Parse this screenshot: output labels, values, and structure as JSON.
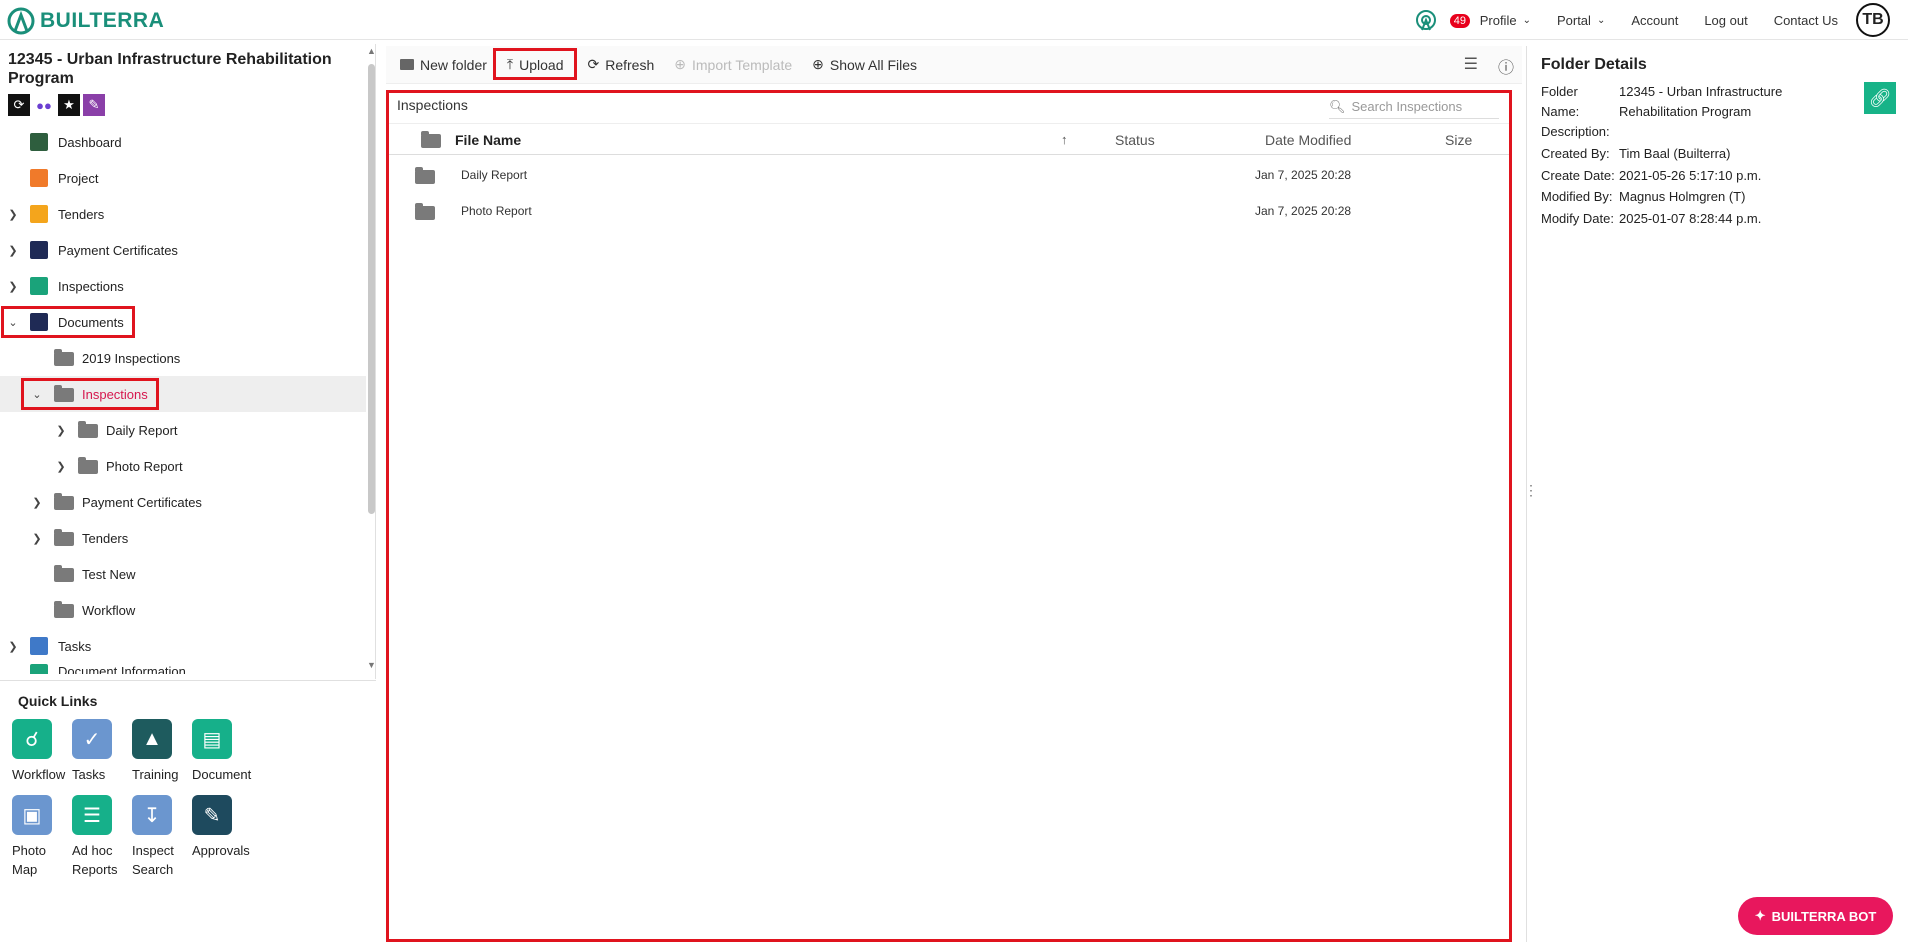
{
  "app": {
    "logo_text": "BUILTERRA"
  },
  "nav": {
    "badge_count": "49",
    "profile": "Profile",
    "portal": "Portal",
    "account": "Account",
    "logout": "Log out",
    "contact": "Contact Us",
    "avatar_initials": "TB"
  },
  "sidebar": {
    "project_title": "12345 - Urban Infrastructure Rehabilitation Program",
    "items": [
      {
        "label": "Dashboard",
        "icon": "dashboard-icon",
        "color": "#2e5e3e"
      },
      {
        "label": "Project",
        "icon": "project-icon",
        "color": "#f07a2a"
      },
      {
        "label": "Tenders",
        "icon": "tenders-icon",
        "color": "#f4a51c"
      },
      {
        "label": "Payment Certificates",
        "icon": "payment-certificates-icon",
        "color": "#1f2a55"
      },
      {
        "label": "Inspections",
        "icon": "inspections-icon",
        "color": "#1aa37a"
      },
      {
        "label": "Documents",
        "icon": "documents-icon",
        "color": "#1f2a55"
      },
      {
        "label": "2019 Inspections"
      },
      {
        "label": "Inspections"
      },
      {
        "label": "Daily Report"
      },
      {
        "label": "Photo Report"
      },
      {
        "label": "Payment Certificates"
      },
      {
        "label": "Tenders"
      },
      {
        "label": "Test New"
      },
      {
        "label": "Workflow"
      },
      {
        "label": "Tasks",
        "icon": "tasks-icon",
        "color": "#3f79c8"
      },
      {
        "label": "Document Information"
      }
    ]
  },
  "quick_links": {
    "title": "Quick Links",
    "items": [
      {
        "label": "Workflow",
        "icon": "workflow-icon",
        "color": "#16b08a"
      },
      {
        "label": "Tasks",
        "icon": "tasks-icon",
        "color": "#6b96cf"
      },
      {
        "label": "Training",
        "icon": "training-icon",
        "color": "#1e5b5e"
      },
      {
        "label": "Document",
        "icon": "document-icon",
        "color": "#16b08a"
      },
      {
        "label": "Photo Map",
        "icon": "photo-map-icon",
        "color": "#6b96cf"
      },
      {
        "label": "Ad hoc Reports",
        "icon": "reports-icon",
        "color": "#16b08a"
      },
      {
        "label": "Inspect Search",
        "icon": "download-icon",
        "color": "#6b96cf"
      },
      {
        "label": "Approvals",
        "icon": "approvals-icon",
        "color": "#1e4a5e"
      }
    ]
  },
  "toolbar": {
    "new_folder": "New folder",
    "upload": "Upload",
    "refresh": "Refresh",
    "import_template": "Import Template",
    "show_all": "Show All Files"
  },
  "files": {
    "title": "Inspections",
    "search_placeholder": "Search Inspections",
    "columns": {
      "name": "File Name",
      "status": "Status",
      "modified": "Date Modified",
      "size": "Size"
    },
    "rows": [
      {
        "name": "Daily Report",
        "status": "",
        "modified": "Jan 7, 2025 20:28",
        "size": ""
      },
      {
        "name": "Photo Report",
        "status": "",
        "modified": "Jan 7, 2025 20:28",
        "size": ""
      }
    ]
  },
  "details": {
    "title": "Folder Details",
    "folder_label_1": "Folder",
    "folder_label_2": "Name:",
    "folder_name": "12345 - Urban Infrastructure Rehabilitation Program",
    "description_label": "Description:",
    "created_by_label": "Created By:",
    "created_by": "Tim Baal (Builterra)",
    "create_date_label": "Create Date:",
    "create_date": "2021-05-26 5:17:10 p.m.",
    "modified_by_label": "Modified By:",
    "modified_by": "Magnus Holmgren (T)",
    "modify_date_label": "Modify Date:",
    "modify_date": "2025-01-07 8:28:44 p.m."
  },
  "bot": {
    "label": "BUILTERRA BOT"
  }
}
